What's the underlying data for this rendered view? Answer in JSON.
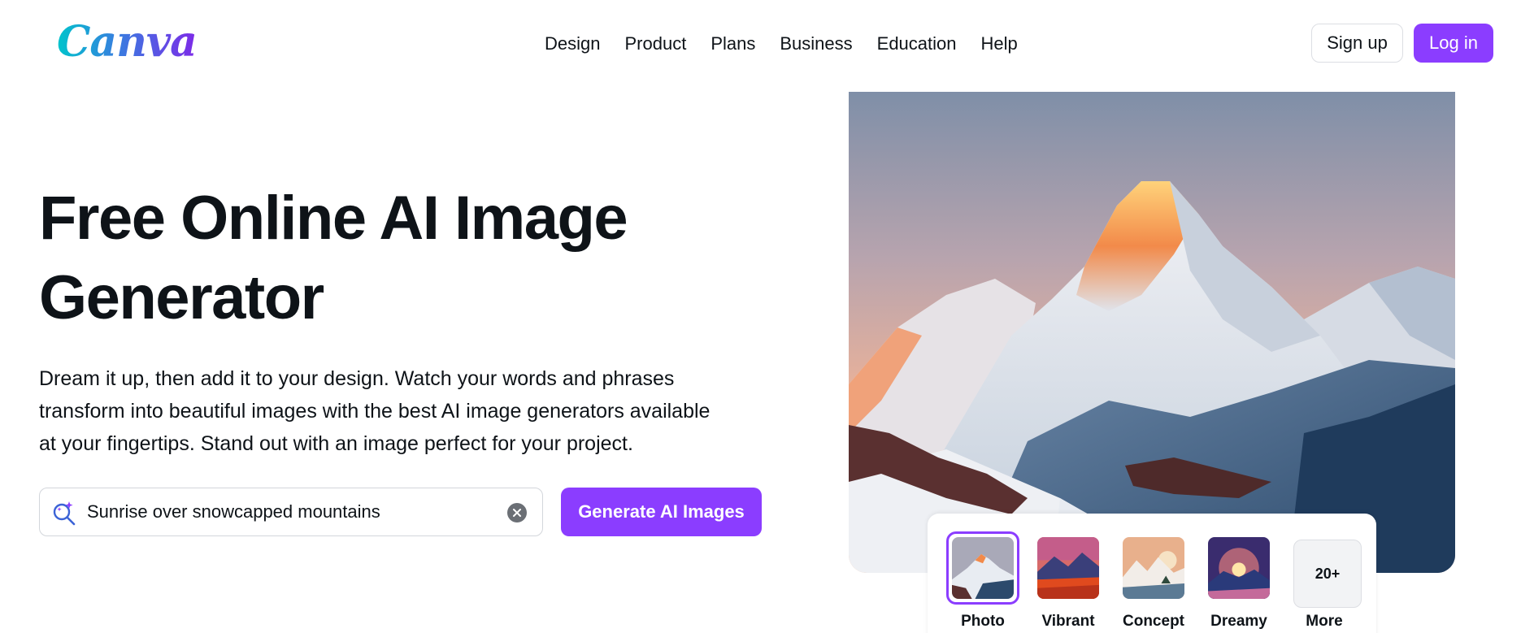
{
  "header": {
    "logo": "Canva",
    "nav": [
      "Design",
      "Product",
      "Plans",
      "Business",
      "Education",
      "Help"
    ],
    "signup_label": "Sign up",
    "login_label": "Log in"
  },
  "hero": {
    "title_line1": "Free Online AI Image",
    "title_line2": "Generator",
    "description_lines": [
      "Dream it up, then add it to your design. Watch your words and phrases",
      "transform into beautiful images with the best AI image generators available",
      "at your fingertips. Stand out with an image perfect for your project."
    ]
  },
  "prompt": {
    "value": "Sunrise over snowcapped mountains",
    "generate_label": "Generate AI Images"
  },
  "styles": {
    "selected": "Photo",
    "items": [
      {
        "label": "Photo"
      },
      {
        "label": "Vibrant"
      },
      {
        "label": "Concept"
      },
      {
        "label": "Dreamy"
      },
      {
        "label": "More",
        "badge": "20+"
      }
    ]
  },
  "colors": {
    "accent": "#8b3dff",
    "text": "#0e1318"
  }
}
